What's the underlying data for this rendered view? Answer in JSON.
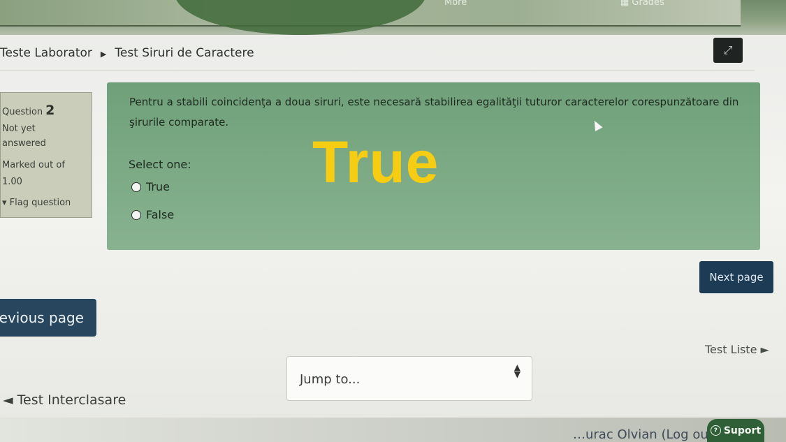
{
  "topbar": {
    "more_label": "More",
    "grades_label": "Grades"
  },
  "breadcrumb": {
    "items": [
      "Teste Laborator",
      "Test Siruri de Caractere"
    ]
  },
  "question_info": {
    "label": "Question",
    "number": "2",
    "status_line1": "Not yet",
    "status_line2": "answered",
    "marked_line1": "Marked out of",
    "marked_line2": "1.00",
    "flag_label": "Flag question"
  },
  "question": {
    "text": "Pentru a stabili coincidenţa a doua siruri, este necesară stabilirea egalităţii tuturor caracterelor corespunzătoare din şirurile comparate.",
    "select_label": "Select one:",
    "options": [
      "True",
      "False"
    ],
    "overlay_answer": "True",
    "overlay_color": "#f6cd12",
    "background_color": "#78a882"
  },
  "navigation": {
    "next_label": "Next page",
    "previous_label": "Previous page",
    "jump_placeholder": "Jump to...",
    "next_activity": "Test Liste ►",
    "previous_activity": "◄ Test Interclasare"
  },
  "footer": {
    "user_text": "…urac Olvian (Log out)",
    "support_label": "Suport"
  }
}
